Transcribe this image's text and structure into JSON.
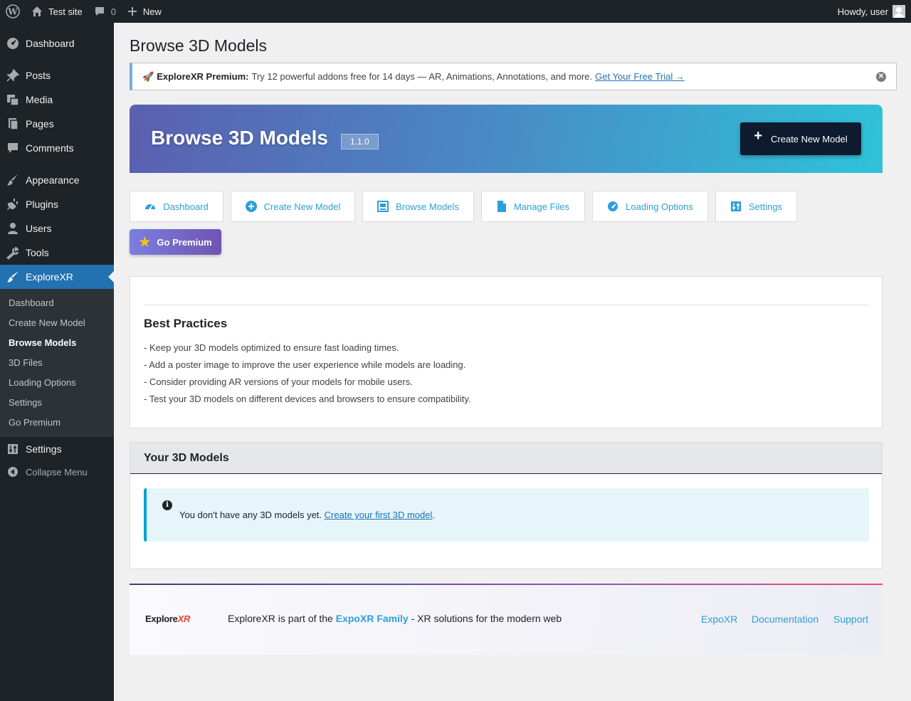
{
  "adminbar": {
    "site_name": "Test site",
    "comments_count": "0",
    "new_label": "New",
    "greeting": "Howdy, user"
  },
  "sidebar": {
    "items": [
      {
        "label": "Dashboard",
        "icon": "dashboard-gauge-icon"
      },
      {
        "label": "Posts",
        "icon": "pushpin-icon"
      },
      {
        "label": "Media",
        "icon": "media-icon"
      },
      {
        "label": "Pages",
        "icon": "pages-icon"
      },
      {
        "label": "Comments",
        "icon": "comment-bubble-icon"
      },
      {
        "label": "Appearance",
        "icon": "paintbrush-icon"
      },
      {
        "label": "Plugins",
        "icon": "plug-icon"
      },
      {
        "label": "Users",
        "icon": "user-icon"
      },
      {
        "label": "Tools",
        "icon": "wrench-icon"
      },
      {
        "label": "ExploreXR",
        "icon": "brush-icon"
      }
    ],
    "submenu": [
      "Dashboard",
      "Create New Model",
      "Browse Models",
      "3D Files",
      "Loading Options",
      "Settings",
      "Go Premium"
    ],
    "settings_label": "Settings",
    "collapse_label": "Collapse Menu"
  },
  "page": {
    "title": "Browse 3D Models"
  },
  "notice": {
    "emoji": "🚀",
    "bold": "ExploreXR Premium:",
    "text": "Try 12 powerful addons free for 14 days — AR, Animations, Annotations, and more.",
    "link": "Get Your Free Trial →"
  },
  "hero": {
    "title": "Browse 3D Models",
    "version": "1.1.0",
    "button_plus": "+",
    "button_label": "Create New Model"
  },
  "nav": {
    "buttons": [
      {
        "label": "Dashboard",
        "icon": "gauge-icon"
      },
      {
        "label": "Create New Model",
        "icon": "plus-circle-icon"
      },
      {
        "label": "Browse Models",
        "icon": "gallery-icon"
      },
      {
        "label": "Manage Files",
        "icon": "file-icon"
      },
      {
        "label": "Loading Options",
        "icon": "performance-icon"
      },
      {
        "label": "Settings",
        "icon": "settings-sliders-icon"
      }
    ],
    "premium_star": "★",
    "premium_label": "Go Premium"
  },
  "best_practices": {
    "title": "Best Practices",
    "items": [
      "- Keep your 3D models optimized to ensure fast loading times.",
      "- Add a poster image to improve the user experience while models are loading.",
      "- Consider providing AR versions of your models for mobile users.",
      "- Test your 3D models on different devices and browsers to ensure compatibility."
    ]
  },
  "models": {
    "title": "Your 3D Models",
    "info_icon": "i",
    "empty_text": "You don't have any 3D models yet.",
    "empty_link": "Create your first 3D model",
    "empty_period": "."
  },
  "footer": {
    "logo_main": "Explore",
    "logo_xr": "XR",
    "tagline_pre": "ExploreXR is part of the",
    "tagline_family": "ExpoXR Family",
    "tagline_post": "- XR solutions for the modern web",
    "links": [
      "ExpoXR",
      "Documentation",
      "Support"
    ]
  },
  "colors": {
    "admin_bg": "#1d2327",
    "accent_blue": "#2271b1",
    "link_cyan": "#2e9fd8",
    "premium_purple": "#7153b3"
  }
}
